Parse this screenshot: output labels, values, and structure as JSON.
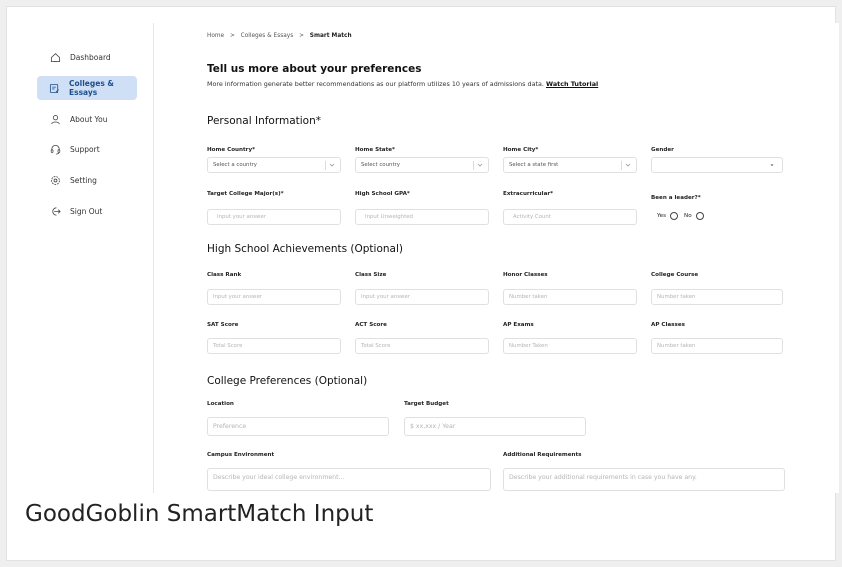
{
  "sidebar": {
    "items": [
      {
        "label": "Dashboard",
        "icon": "home-icon"
      },
      {
        "label": "Colleges & Essays",
        "icon": "document-icon",
        "active": true
      },
      {
        "label": "About You",
        "icon": "user-icon"
      },
      {
        "label": "Support",
        "icon": "headset-icon"
      },
      {
        "label": "Setting",
        "icon": "gear-icon"
      },
      {
        "label": "Sign Out",
        "icon": "sign-out-icon"
      }
    ]
  },
  "breadcrumb": {
    "home": "Home",
    "sep": ">",
    "colleges": "Colleges & Essays",
    "current": "Smart Match"
  },
  "header": {
    "title": "Tell us more about your preferences",
    "subtitle": "More information generate better recommendations as our platform utilizes 10 years of admissions data.",
    "tutorial_link": "Watch Tutorial"
  },
  "personal": {
    "title": "Personal Information*",
    "home_country": {
      "label": "Home Country*",
      "value": "Select a country"
    },
    "home_state": {
      "label": "Home State*",
      "value": "Select country"
    },
    "home_city": {
      "label": "Home City*",
      "value": "Select a state first"
    },
    "gender": {
      "label": "Gender",
      "value": ""
    },
    "major": {
      "label": "Target College Major(s)*",
      "placeholder": "Input your answer"
    },
    "gpa": {
      "label": "High School GPA*",
      "placeholder": "Input Unweighted"
    },
    "extracurricular": {
      "label": "Extracurricular*",
      "placeholder": "Activity Count"
    },
    "leader": {
      "label": "Been a leader?*",
      "yes": "Yes",
      "no": "No"
    }
  },
  "achievements": {
    "title": "High School Achievements (Optional)",
    "class_rank": {
      "label": "Class Rank",
      "placeholder": "Input your answer"
    },
    "class_size": {
      "label": "Class Size",
      "placeholder": "Input your answer"
    },
    "honor_classes": {
      "label": "Honor Classes",
      "placeholder": "Number taken"
    },
    "college_course": {
      "label": "College Course",
      "placeholder": "Number taken"
    },
    "sat": {
      "label": "SAT Score",
      "placeholder": "Total Score"
    },
    "act": {
      "label": "ACT Score",
      "placeholder": "Total Score"
    },
    "ap_exams": {
      "label": "AP Exams",
      "placeholder": "Number Taken"
    },
    "ap_classes": {
      "label": "AP Classes",
      "placeholder": "Number taken"
    }
  },
  "preferences": {
    "title": "College Preferences (Optional)",
    "location": {
      "label": "Location",
      "placeholder": "Preference"
    },
    "budget": {
      "label": "Target Budget",
      "placeholder": "$ xx,xxx / Year"
    },
    "campus": {
      "label": "Campus Environment",
      "placeholder": "Describe your ideal college environment..."
    },
    "additional": {
      "label": "Additional Requirements",
      "placeholder": "Describe your additional requirements in case you have any."
    }
  },
  "caption": "GoodGoblin SmartMatch Input",
  "colors": {
    "active_bg": "#cfe0f6",
    "active_text": "#1f4f8b"
  }
}
